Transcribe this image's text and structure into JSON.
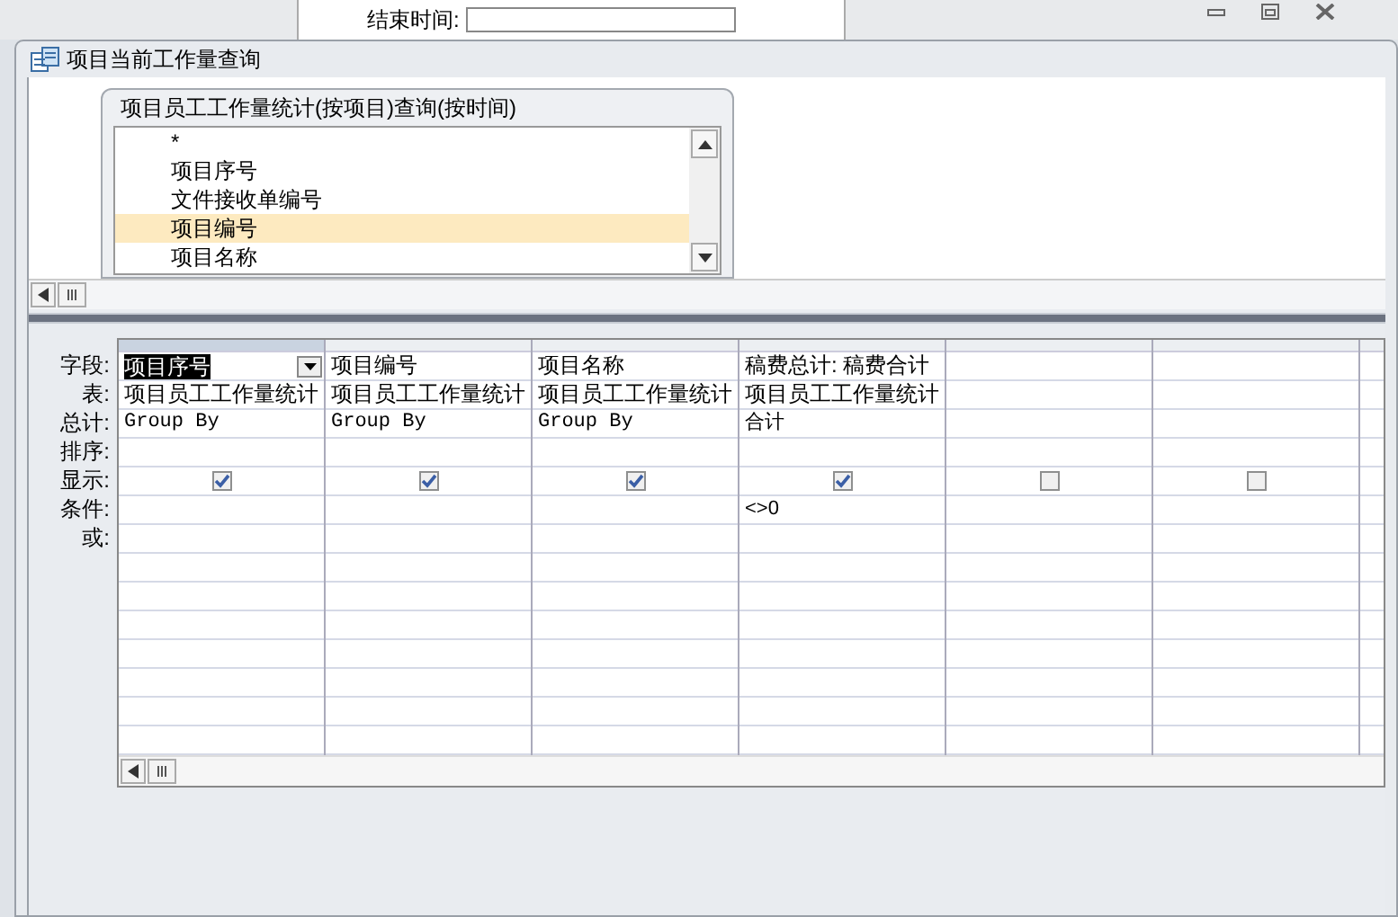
{
  "background_form": {
    "label": "结束时间:"
  },
  "window": {
    "title": "项目当前工作量查询"
  },
  "table_box": {
    "title": "项目员工工作量统计(按项目)查询(按时间)",
    "fields": [
      {
        "name": "*",
        "selected": false
      },
      {
        "name": "项目序号",
        "selected": false
      },
      {
        "name": "文件接收单编号",
        "selected": false
      },
      {
        "name": "项目编号",
        "selected": true
      },
      {
        "name": "项目名称",
        "selected": false
      }
    ]
  },
  "grid": {
    "row_labels": [
      "字段:",
      "表:",
      "总计:",
      "排序:",
      "显示:",
      "条件:",
      "或:"
    ],
    "columns": [
      {
        "field": "项目序号",
        "table": "项目员工工作量统计",
        "total": "Group By",
        "show": true,
        "selected": true
      },
      {
        "field": "项目编号",
        "table": "项目员工工作量统计",
        "total": "Group By",
        "show": true,
        "selected": false
      },
      {
        "field": "项目名称",
        "table": "项目员工工作量统计",
        "total": "Group By",
        "show": true,
        "selected": false
      },
      {
        "field": "稿费总计: 稿费合计",
        "table": "项目员工工作量统计",
        "total": "合计",
        "show": true,
        "criteria": "<>0",
        "selected": false
      },
      {
        "show": false,
        "selected": false
      },
      {
        "show": false,
        "selected": false
      }
    ]
  }
}
